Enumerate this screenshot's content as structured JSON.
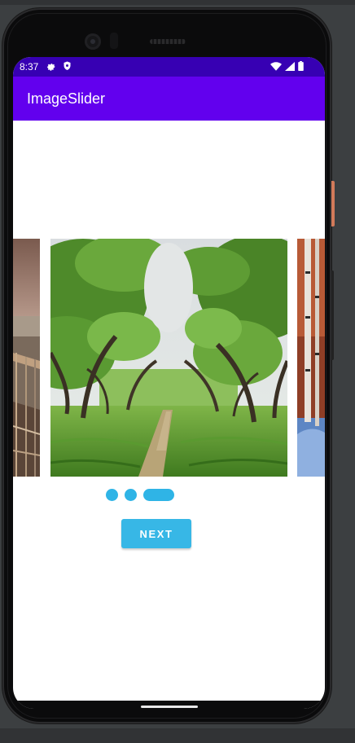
{
  "status_bar": {
    "time": "8:37",
    "left_icons": [
      "settings-gear-icon",
      "shield-icon"
    ],
    "right_icons": [
      "wifi-icon",
      "signal-icon",
      "battery-icon"
    ]
  },
  "app_bar": {
    "title": "ImageSlider",
    "color": "#6200ee"
  },
  "status_bar_color": "#3700b3",
  "slider": {
    "slides": [
      {
        "position": "previous",
        "subject": "wooden boardwalk over water"
      },
      {
        "position": "current",
        "subject": "tree-lined grassy dirt path"
      },
      {
        "position": "next",
        "subject": "birch trees in snow"
      }
    ],
    "indicator": {
      "count": 3,
      "active_index": 2,
      "color": "#2fb4e6"
    }
  },
  "next_button": {
    "label": "NEXT",
    "color": "#37b7e6"
  }
}
